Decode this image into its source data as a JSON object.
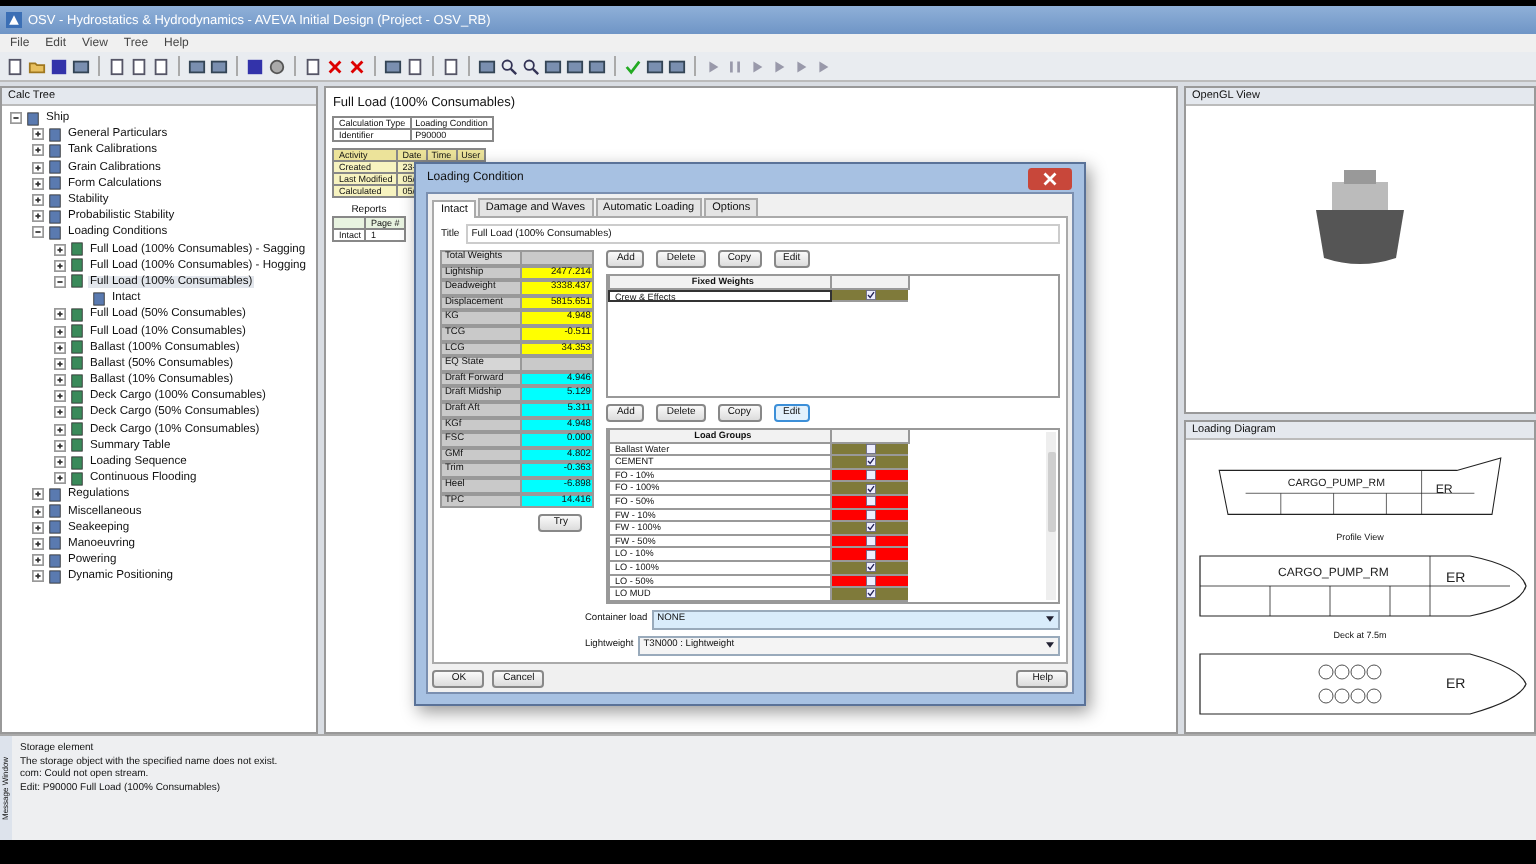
{
  "window": {
    "title": "OSV - Hydrostatics & Hydrodynamics - AVEVA Initial Design (Project - OSV_RB)"
  },
  "menu": [
    "File",
    "Edit",
    "View",
    "Tree",
    "Help"
  ],
  "calc_tree": {
    "title": "Calc Tree",
    "items": [
      {
        "label": "Ship",
        "expanded": true,
        "children": [
          {
            "label": "General Particulars",
            "expanded": false
          },
          {
            "label": "Tank Calibrations",
            "expanded": false
          },
          {
            "label": "Grain Calibrations",
            "expanded": false
          },
          {
            "label": "Form Calculations",
            "expanded": false
          },
          {
            "label": "Stability",
            "expanded": false
          },
          {
            "label": "Probabilistic Stability",
            "expanded": false
          },
          {
            "label": "Loading Conditions",
            "expanded": true,
            "children": [
              {
                "label": "Full Load (100% Consumables) - Sagging",
                "expanded": false
              },
              {
                "label": "Full Load (100% Consumables) - Hogging",
                "expanded": false
              },
              {
                "label": "Full Load (100% Consumables)",
                "expanded": true,
                "selected": true,
                "children": [
                  {
                    "label": "Intact"
                  }
                ]
              },
              {
                "label": "Full Load (50% Consumables)",
                "expanded": false
              },
              {
                "label": "Full Load (10% Consumables)",
                "expanded": false
              },
              {
                "label": "Ballast (100% Consumables)",
                "expanded": false
              },
              {
                "label": "Ballast (50% Consumables)",
                "expanded": false
              },
              {
                "label": "Ballast (10% Consumables)",
                "expanded": false
              },
              {
                "label": "Deck Cargo (100% Consumables)",
                "expanded": false
              },
              {
                "label": "Deck Cargo (50% Consumables)",
                "expanded": false
              },
              {
                "label": "Deck Cargo (10% Consumables)",
                "expanded": false
              },
              {
                "label": "Summary Table",
                "expanded": false
              },
              {
                "label": "Loading Sequence",
                "expanded": false
              },
              {
                "label": "Continuous Flooding",
                "expanded": false
              }
            ]
          },
          {
            "label": "Regulations",
            "expanded": false
          },
          {
            "label": "Miscellaneous",
            "expanded": false
          },
          {
            "label": "Seakeeping",
            "expanded": false
          },
          {
            "label": "Manoeuvring",
            "expanded": false
          },
          {
            "label": "Powering",
            "expanded": false
          },
          {
            "label": "Dynamic Positioning",
            "expanded": false
          }
        ]
      }
    ]
  },
  "document": {
    "title": "Full Load (100% Consumables)",
    "id_table": {
      "columns": [
        "Calculation Type",
        "Loading Condition"
      ],
      "rows": [
        [
          "Identifier",
          "P90000"
        ]
      ]
    },
    "activity_table": {
      "columns": [
        "Activity",
        "Date",
        "Time",
        "User"
      ],
      "rows": [
        [
          "Created",
          "23-"
        ],
        [
          "Last Modified",
          "05/"
        ],
        [
          "Calculated",
          "05/"
        ]
      ]
    },
    "reports": {
      "title": "Reports",
      "column": "Page #",
      "rows": [
        [
          "Intact",
          "1"
        ]
      ]
    }
  },
  "dialog": {
    "title": "Loading Condition",
    "tabs": [
      {
        "label": "Intact",
        "selected": true
      },
      {
        "label": "Damage and Waves",
        "selected": false
      },
      {
        "label": "Automatic Loading",
        "selected": false
      },
      {
        "label": "Options",
        "selected": false
      }
    ],
    "title_label": "Title",
    "title_value": "Full Load (100% Consumables)",
    "weights": [
      {
        "kind": "header",
        "label": "Total Weights"
      },
      {
        "kind": "value",
        "label": "Lightship",
        "value": "2477.214",
        "color": "#ffff00"
      },
      {
        "kind": "value",
        "label": "Deadweight",
        "value": "3338.437",
        "color": "#ffff00"
      },
      {
        "kind": "value",
        "label": "Displacement",
        "value": "5815.651",
        "color": "#ffff00"
      },
      {
        "kind": "value",
        "label": "KG",
        "value": "4.948",
        "color": "#ffff00"
      },
      {
        "kind": "value",
        "label": "TCG",
        "value": "-0.511",
        "color": "#ffff00"
      },
      {
        "kind": "value",
        "label": "LCG",
        "value": "34.353",
        "color": "#ffff00"
      },
      {
        "kind": "header",
        "label": "EQ State"
      },
      {
        "kind": "value",
        "label": "Draft Forward",
        "value": "4.946",
        "color": "#00ffff"
      },
      {
        "kind": "value",
        "label": "Draft Midship",
        "value": "5.129",
        "color": "#00ffff"
      },
      {
        "kind": "value",
        "label": "Draft Aft",
        "value": "5.311",
        "color": "#00ffff"
      },
      {
        "kind": "value",
        "label": "KGf",
        "value": "4.948",
        "color": "#00ffff"
      },
      {
        "kind": "value",
        "label": "FSC",
        "value": "0.000",
        "color": "#00ffff"
      },
      {
        "kind": "value",
        "label": "GMf",
        "value": "4.802",
        "color": "#00ffff"
      },
      {
        "kind": "value",
        "label": "Trim",
        "value": "-0.363",
        "color": "#00ffff"
      },
      {
        "kind": "value",
        "label": "Heel",
        "value": "-6.898",
        "color": "#00ffff"
      },
      {
        "kind": "value",
        "label": "TPC",
        "value": "14.416",
        "color": "#00ffff"
      }
    ],
    "try_button": "Try",
    "fixed_buttons": [
      "Add",
      "Delete",
      "Copy",
      "Edit"
    ],
    "fixed_weights": {
      "column": "Fixed Weights",
      "rows": [
        {
          "name": "Crew & Effects",
          "checked": true,
          "color": "#7f7a3a"
        }
      ]
    },
    "group_buttons": [
      "Add",
      "Delete",
      "Copy",
      "Edit"
    ],
    "load_groups": {
      "column": "Load Groups",
      "rows": [
        {
          "name": "Ballast Water",
          "checked": false,
          "color": "#7f7a3a"
        },
        {
          "name": "CEMENT",
          "checked": true,
          "color": "#7f7a3a"
        },
        {
          "name": "FO - 10%",
          "checked": false,
          "color": "#ff0000"
        },
        {
          "name": "FO - 100%",
          "checked": true,
          "color": "#7f7a3a"
        },
        {
          "name": "FO - 50%",
          "checked": false,
          "color": "#ff0000"
        },
        {
          "name": "FW - 10%",
          "checked": false,
          "color": "#ff0000"
        },
        {
          "name": "FW - 100%",
          "checked": true,
          "color": "#7f7a3a"
        },
        {
          "name": "FW - 50%",
          "checked": false,
          "color": "#ff0000"
        },
        {
          "name": "LO - 10%",
          "checked": false,
          "color": "#ff0000"
        },
        {
          "name": "LO - 100%",
          "checked": true,
          "color": "#7f7a3a"
        },
        {
          "name": "LO - 50%",
          "checked": false,
          "color": "#ff0000"
        },
        {
          "name": "LO MUD",
          "checked": true,
          "color": "#7f7a3a"
        }
      ]
    },
    "container_label": "Container load",
    "container_value": "NONE",
    "lightweight_label": "Lightweight",
    "lightweight_value": "T3N000 : Lightweight",
    "ok": "OK",
    "cancel": "Cancel",
    "help": "Help"
  },
  "opengl_view": {
    "title": "OpenGL View"
  },
  "loading_diagram": {
    "title": "Loading Diagram",
    "labels": [
      "CARGO_PUMP_RM",
      "ER",
      "Profile View",
      "CARGO_PUMP_RM",
      "ER",
      "Deck at 7.5m",
      "ER"
    ]
  },
  "messages": {
    "title": "Message Window",
    "lines": [
      "Storage element",
      "The storage object with the specified name does not exist.",
      "com: Could not open stream.",
      "Edit: P90000 Full Load (100% Consumables)"
    ]
  }
}
